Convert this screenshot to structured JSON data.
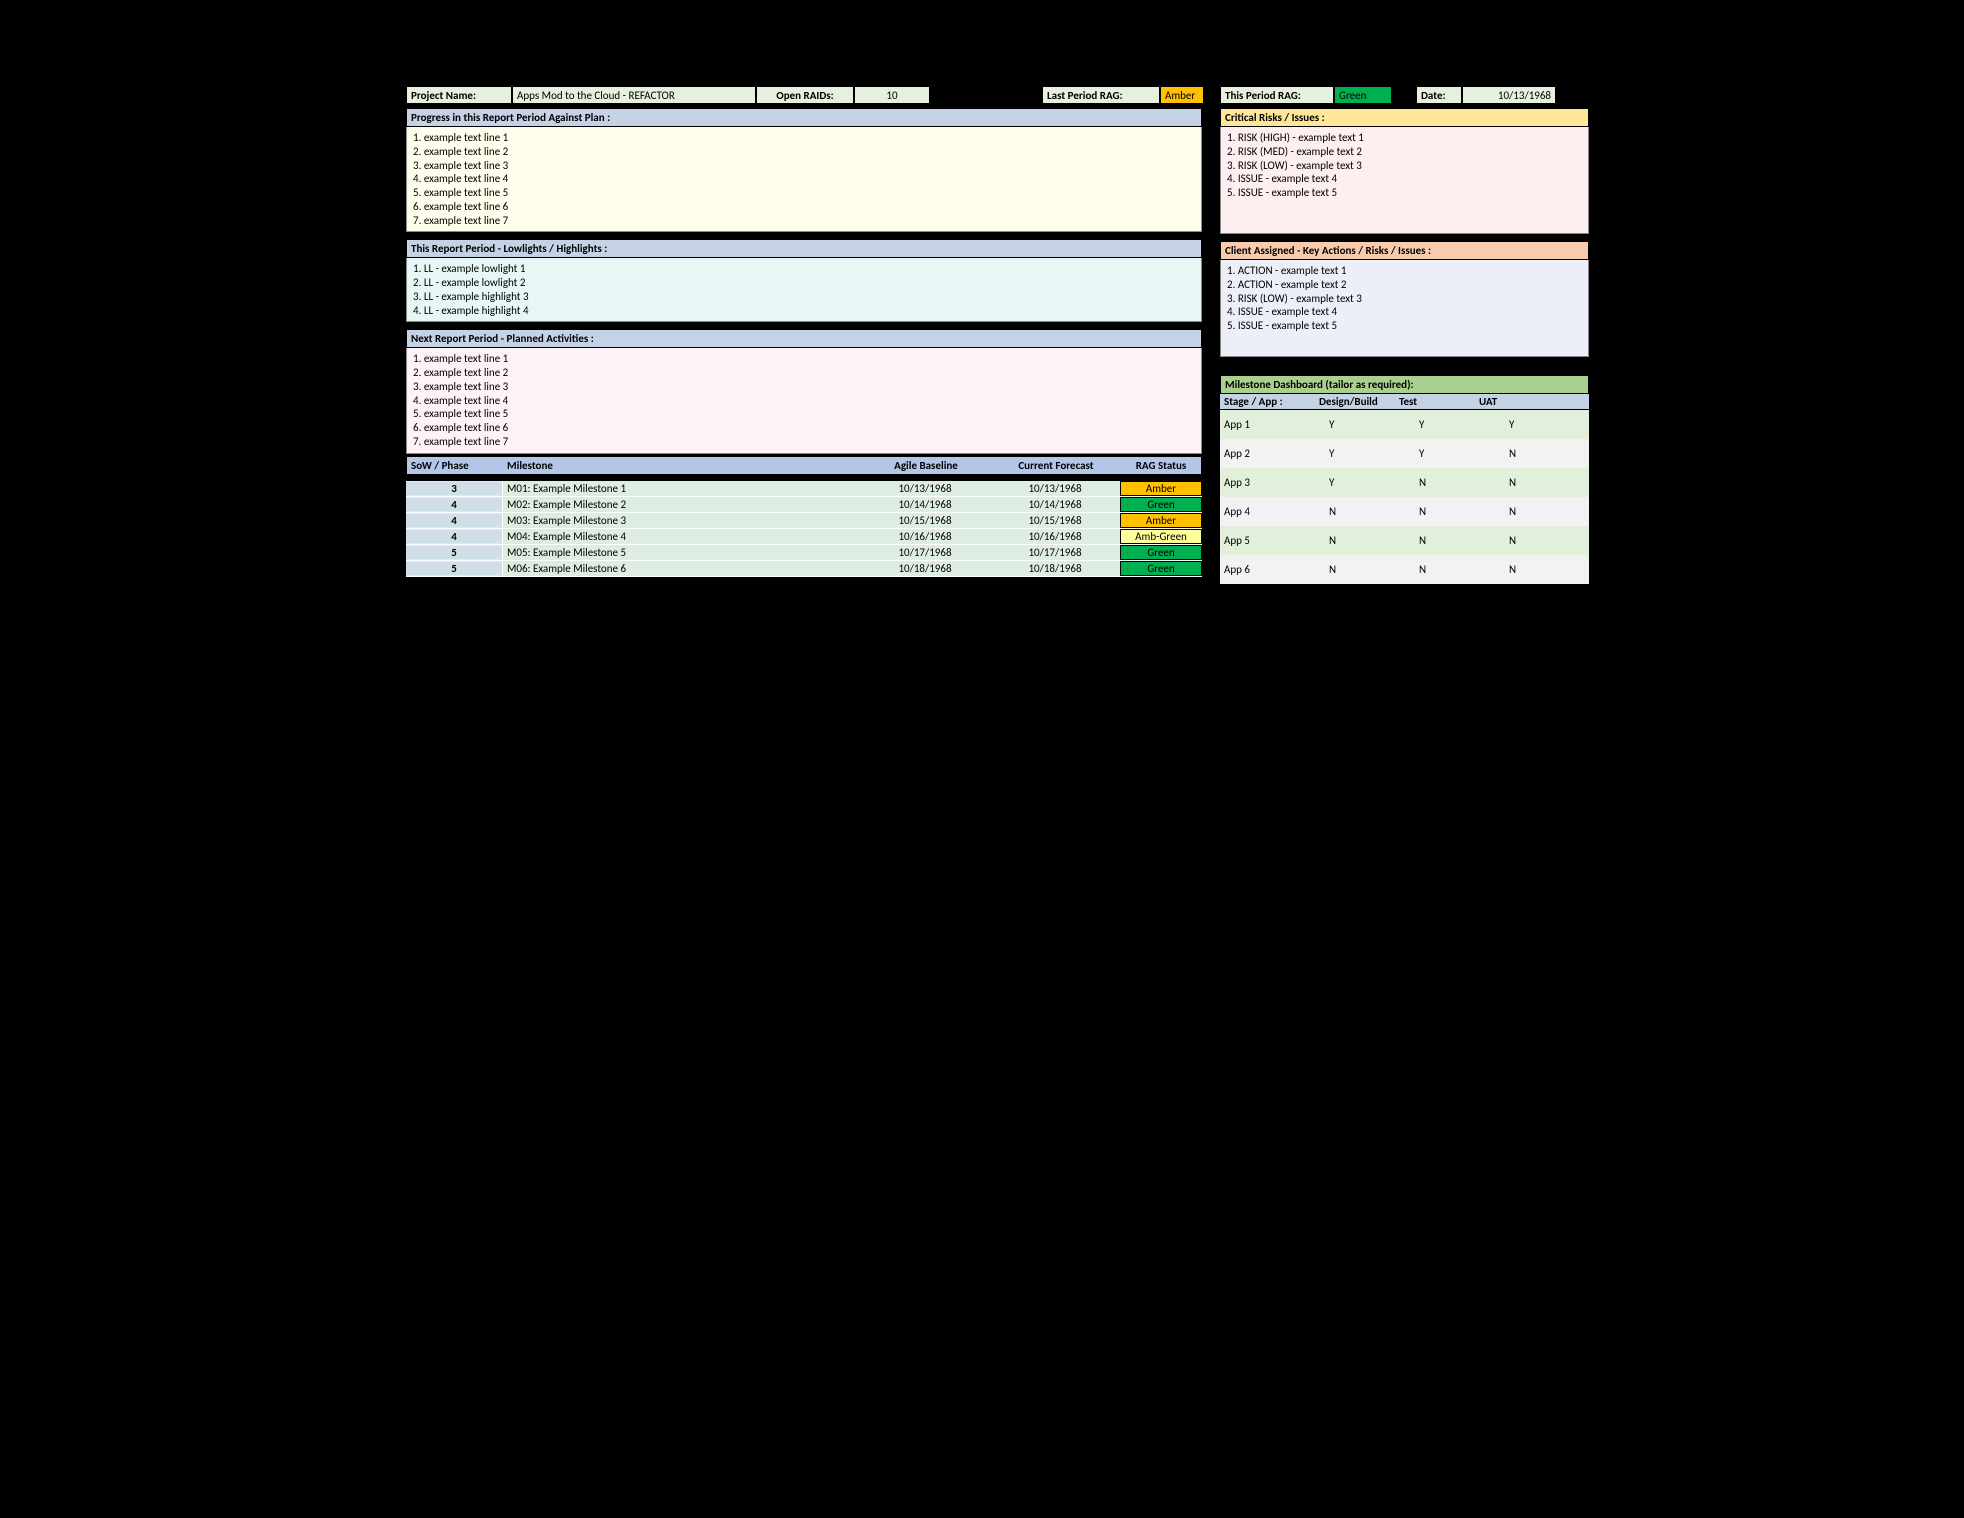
{
  "header": {
    "labels": {
      "project_name": "Project Name:",
      "open_raids": "Open RAIDs:",
      "last_period_rag": "Last Period RAG:",
      "this_period_rag": "This Period RAG:",
      "date": "Date:"
    },
    "project_name": "Apps Mod to the Cloud - REFACTOR",
    "open_raids": "10",
    "last_period_rag": "Amber",
    "this_period_rag": "Green",
    "date": "10/13/1968"
  },
  "sections": {
    "progress_title": "Progress in this Report Period Against Plan :",
    "progress_items": [
      "1. example text line 1",
      "2. example text line 2",
      "3. example text line 3",
      "4. example text line 4",
      "5. example text line 5",
      "6. example text line 6",
      "7. example text line 7"
    ],
    "lowhigh_title": "This Report Period - Lowlights / Highlights :",
    "lowhigh_items": [
      "1. LL - example lowlight 1",
      "2. LL - example lowlight 2",
      "3. LL - example highlight 3",
      "4. LL - example highlight 4"
    ],
    "planned_title": "Next Report Period - Planned Activities :",
    "planned_items": [
      "1. example text line 1",
      "2. example text line 2",
      "3. example text line 3",
      "4. example text line 4",
      "5. example text line 5",
      "6. example text line 6",
      "7. example text line 7"
    ],
    "risks_title": "Critical Risks / Issues :",
    "risks_items": [
      "1. RISK (HIGH) - example text 1",
      "2. RISK (MED) - example text 2",
      "3. RISK (LOW) - example text 3",
      "4. ISSUE - example text 4",
      "5. ISSUE - example text 5"
    ],
    "client_title": "Client Assigned - Key Actions / Risks / Issues :",
    "client_items": [
      "1. ACTION - example text 1",
      "2. ACTION - example text 2",
      "3. RISK (LOW) - example text 3",
      "4. ISSUE - example text 4",
      "5. ISSUE - example text 5"
    ]
  },
  "milestones": {
    "headers": {
      "phase": "SoW / Phase",
      "milestone": "Milestone",
      "baseline": "Agile Baseline",
      "forecast": "Current Forecast",
      "rag": "RAG Status"
    },
    "rows": [
      {
        "phase": "3",
        "milestone": "M01: Example Milestone 1",
        "baseline": "10/13/1968",
        "forecast": "10/13/1968",
        "rag": "Amber",
        "rag_class": "rag-amber"
      },
      {
        "phase": "4",
        "milestone": "M02: Example Milestone 2",
        "baseline": "10/14/1968",
        "forecast": "10/14/1968",
        "rag": "Green",
        "rag_class": "rag-green"
      },
      {
        "phase": "4",
        "milestone": "M03: Example Milestone 3",
        "baseline": "10/15/1968",
        "forecast": "10/15/1968",
        "rag": "Amber",
        "rag_class": "rag-amber"
      },
      {
        "phase": "4",
        "milestone": "M04: Example Milestone 4",
        "baseline": "10/16/1968",
        "forecast": "10/16/1968",
        "rag": "Amb-Green",
        "rag_class": "rag-ambgreen"
      },
      {
        "phase": "5",
        "milestone": "M05: Example Milestone 5",
        "baseline": "10/17/1968",
        "forecast": "10/17/1968",
        "rag": "Green",
        "rag_class": "rag-green"
      },
      {
        "phase": "5",
        "milestone": "M06: Example Milestone 6",
        "baseline": "10/18/1968",
        "forecast": "10/18/1968",
        "rag": "Green",
        "rag_class": "rag-green"
      }
    ]
  },
  "dashboard": {
    "title": "Milestone Dashboard (tailor as required):",
    "headers": {
      "stage": "Stage / App :",
      "c1": "Design/Build",
      "c2": "Test",
      "c3": "UAT"
    },
    "rows": [
      {
        "app": "App 1",
        "c1": "Y",
        "c2": "Y",
        "c3": "Y"
      },
      {
        "app": "App 2",
        "c1": "Y",
        "c2": "Y",
        "c3": "N"
      },
      {
        "app": "App 3",
        "c1": "Y",
        "c2": "N",
        "c3": "N"
      },
      {
        "app": "App 4",
        "c1": "N",
        "c2": "N",
        "c3": "N"
      },
      {
        "app": "App 5",
        "c1": "N",
        "c2": "N",
        "c3": "N"
      },
      {
        "app": "App 6",
        "c1": "N",
        "c2": "N",
        "c3": "N"
      }
    ]
  }
}
